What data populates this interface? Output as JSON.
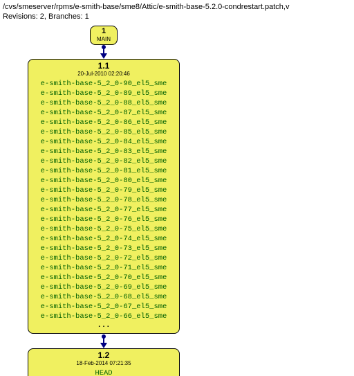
{
  "header": {
    "path": "/cvs/smeserver/rpms/e-smith-base/sme8/Attic/e-smith-base-5.2.0-condrestart.patch,v",
    "revline": "Revisions: 2, Branches: 1"
  },
  "nodes": {
    "top": {
      "number": "1",
      "label": "MAIN"
    },
    "mid": {
      "number": "1.1",
      "date": "20-Jul-2010 02:20:46",
      "tags": [
        "e-smith-base-5_2_0-90_el5_sme",
        "e-smith-base-5_2_0-89_el5_sme",
        "e-smith-base-5_2_0-88_el5_sme",
        "e-smith-base-5_2_0-87_el5_sme",
        "e-smith-base-5_2_0-86_el5_sme",
        "e-smith-base-5_2_0-85_el5_sme",
        "e-smith-base-5_2_0-84_el5_sme",
        "e-smith-base-5_2_0-83_el5_sme",
        "e-smith-base-5_2_0-82_el5_sme",
        "e-smith-base-5_2_0-81_el5_sme",
        "e-smith-base-5_2_0-80_el5_sme",
        "e-smith-base-5_2_0-79_el5_sme",
        "e-smith-base-5_2_0-78_el5_sme",
        "e-smith-base-5_2_0-77_el5_sme",
        "e-smith-base-5_2_0-76_el5_sme",
        "e-smith-base-5_2_0-75_el5_sme",
        "e-smith-base-5_2_0-74_el5_sme",
        "e-smith-base-5_2_0-73_el5_sme",
        "e-smith-base-5_2_0-72_el5_sme",
        "e-smith-base-5_2_0-71_el5_sme",
        "e-smith-base-5_2_0-70_el5_sme",
        "e-smith-base-5_2_0-69_el5_sme",
        "e-smith-base-5_2_0-68_el5_sme",
        "e-smith-base-5_2_0-67_el5_sme",
        "e-smith-base-5_2_0-66_el5_sme"
      ],
      "ellipsis": "..."
    },
    "bot": {
      "number": "1.2",
      "date": "18-Feb-2014 07:21:35",
      "label": "HEAD"
    }
  }
}
